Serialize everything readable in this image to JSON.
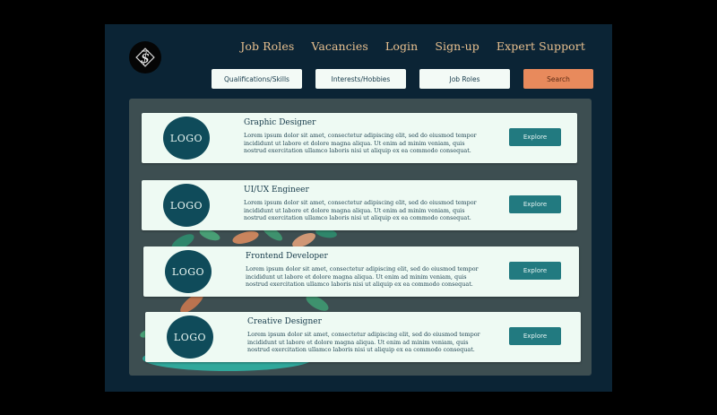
{
  "brand": {
    "logo_icon": "dollar-monogram-icon"
  },
  "nav": [
    "Job Roles",
    "Vacancies",
    "Login",
    "Sign-up",
    "Expert Support"
  ],
  "filters": [
    "Qualifications/Skills",
    "Interests/Hobbies",
    "Job Roles"
  ],
  "search_label": "Search",
  "colors": {
    "accent": "#e88a5c",
    "primary": "#227a80",
    "bg": "#0b2435"
  },
  "cards": [
    {
      "logo": "LOGO",
      "title": "Graphic Designer",
      "desc": "Lorem ipsum dolor sit amet, consectetur adipiscing elit, sed do eiusmod tempor incididunt ut labore et dolore magna aliqua. Ut enim ad minim veniam, quis nostrud exercitation ullamco laboris nisi ut aliquip ex ea commodo consequat.",
      "button": "Explore"
    },
    {
      "logo": "LOGO",
      "title": "UI/UX Engineer",
      "desc": "Lorem ipsum dolor sit amet, consectetur adipiscing elit, sed do eiusmod tempor incididunt ut labore et dolore magna aliqua. Ut enim ad minim veniam, quis nostrud exercitation ullamco laboris nisi ut aliquip ex ea commodo consequat.",
      "button": "Explore"
    },
    {
      "logo": "LOGO",
      "title": "Frontend Developer",
      "desc": "Lorem ipsum dolor sit amet, consectetur adipiscing elit, sed do eiusmod tempor incididunt ut labore et dolore magna aliqua. Ut enim ad minim veniam, quis nostrud exercitation ullamco laboris nisi ut aliquip ex ea commodo consequat.",
      "button": "Explore"
    },
    {
      "logo": "LOGO",
      "title": "Creative Designer",
      "desc": "Lorem ipsum dolor sit amet, consectetur adipiscing elit, sed do eiusmod tempor incididunt ut labore et dolore magna aliqua. Ut enim ad minim veniam, quis nostrud exercitation ullamco laboris nisi ut aliquip ex ea commodo consequat.",
      "button": "Explore"
    }
  ]
}
